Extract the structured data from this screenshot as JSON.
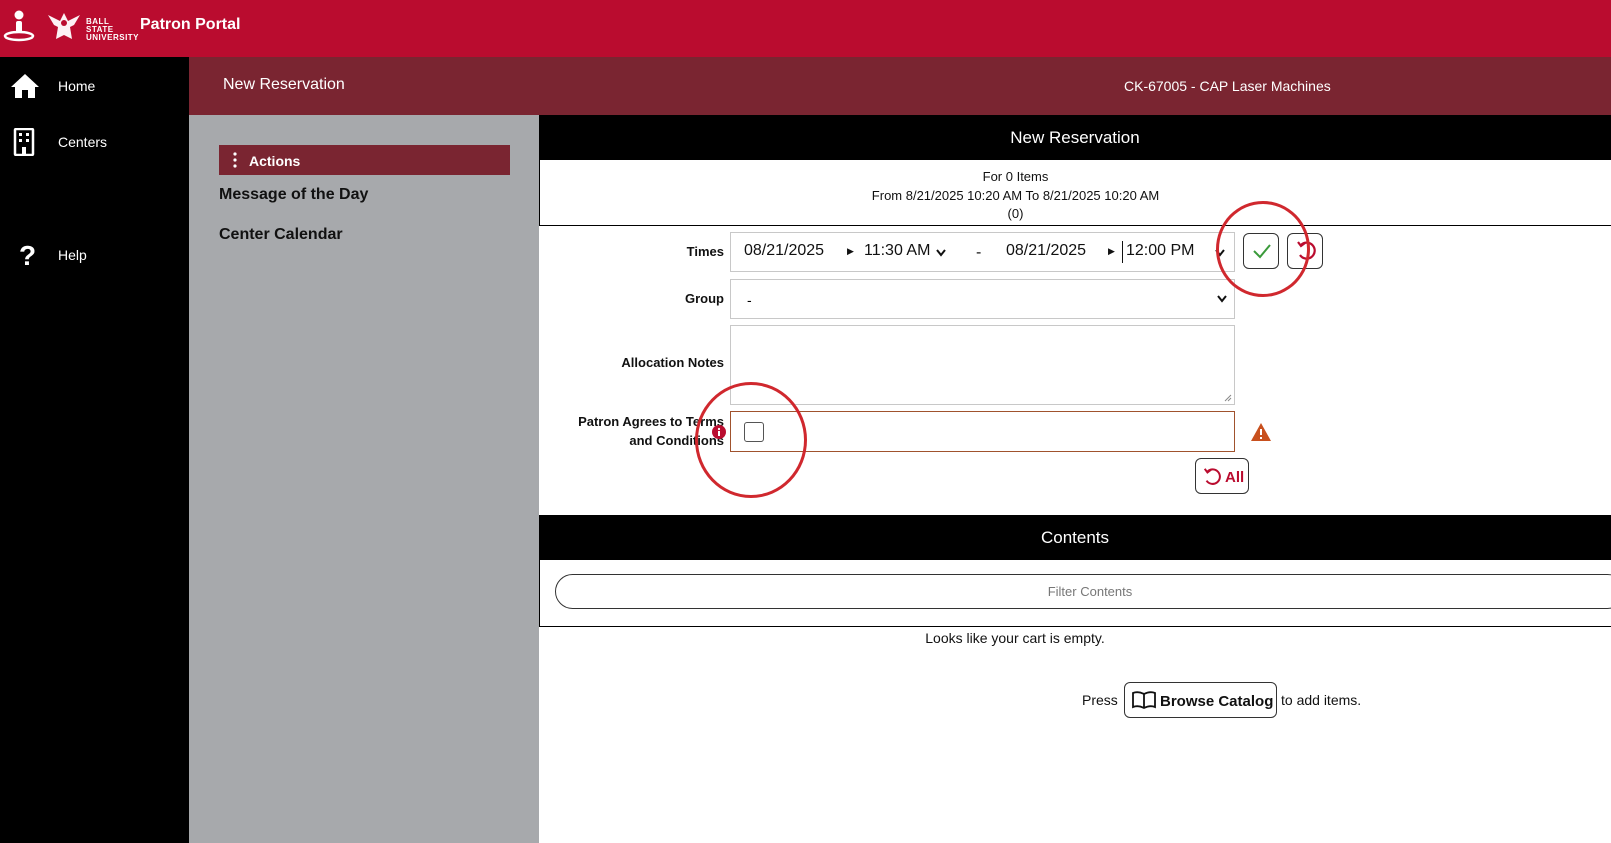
{
  "app": {
    "logo_text": "BALL STATE UNIVERSITY",
    "title": "Patron Portal"
  },
  "sidebar": {
    "items": [
      {
        "label": "Home",
        "icon": "home-icon"
      },
      {
        "label": "Centers",
        "icon": "building-icon"
      },
      {
        "label": "Help",
        "icon": "question-icon"
      }
    ]
  },
  "header": {
    "page_title": "New Reservation",
    "center": "CK-67005 - CAP Laser Machines"
  },
  "action_panel": {
    "actions_label": "Actions",
    "links": [
      "Message of the Day",
      "Center Calendar"
    ]
  },
  "reservation": {
    "section_title": "New Reservation",
    "items_line": "For 0 Items",
    "range_line": "From 8/21/2025 10:20 AM To 8/21/2025 10:20 AM",
    "count_line": "(0)",
    "times_label": "Times",
    "start_date": "08/21/2025",
    "start_time": "11:30 AM",
    "separator": "-",
    "end_date": "08/21/2025",
    "end_time": "12:00 PM",
    "group_label": "Group",
    "group_value": "-",
    "notes_label": "Allocation Notes",
    "terms_label_1": "Patron Agrees to Terms",
    "terms_label_2": "and Conditions",
    "terms_checked": false,
    "reset_all_label": "All"
  },
  "contents": {
    "section_title": "Contents",
    "filter_placeholder": "Filter Contents",
    "empty_message": "Looks like your cart is empty.",
    "press_label": "Press",
    "browse_label": "Browse Catalog",
    "add_items_label": "to add items."
  },
  "colors": {
    "brand_red": "#ba0c2f",
    "maroon": "#7a2531",
    "sidebar": "#000000",
    "panel_gray": "#a7a9ac",
    "confirm_green": "#3a9a3a",
    "warning": "#c8501e",
    "annotation": "#d0282e"
  }
}
